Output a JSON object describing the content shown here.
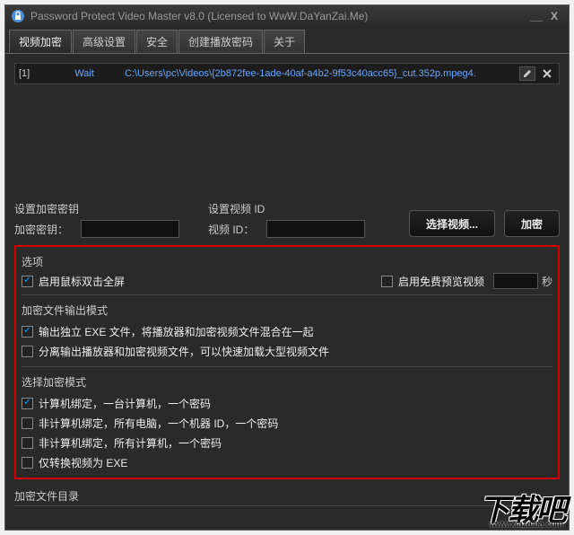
{
  "window": {
    "title": "Password Protect Video Master v8.0 (Licensed to WwW.DaYanZai.Me)"
  },
  "tabs": [
    "视频加密",
    "高级设置",
    "安全",
    "创建播放密码",
    "关于"
  ],
  "fileRow": {
    "index": "[1]",
    "status": "Wait",
    "path": "C:\\Users\\pc\\Videos\\{2b872fee-1ade-40af-a4b2-9f53c40acc65}_cut.352p.mpeg4."
  },
  "labels": {
    "setKey": "设置加密密钥",
    "keyLabel": "加密密钥：",
    "setVideoId": "设置视频 ID",
    "videoIdLabel": "视频 ID：",
    "selectVideo": "选择视频...",
    "encrypt": "加密",
    "options": "选项",
    "dblClickFull": "启用鼠标双击全屏",
    "freePreview": "启用免费预览视频",
    "seconds": "秒",
    "outputMode": "加密文件输出模式",
    "opt1": "输出独立 EXE 文件，将播放器和加密视频文件混合在一起",
    "opt2": "分离输出播放器和加密视频文件，可以快速加载大型视频文件",
    "selectMode": "选择加密模式",
    "mode1": "计算机绑定，一台计算机，一个密码",
    "mode2": "非计算机绑定，所有电脑，一个机器 ID，一个密码",
    "mode3": "非计算机绑定，所有计算机，一个密码",
    "mode4": "仅转换视频为 EXE",
    "outDir": "加密文件目录"
  },
  "watermark": {
    "text": "下载吧",
    "url": "www.xiazaiba.com"
  }
}
